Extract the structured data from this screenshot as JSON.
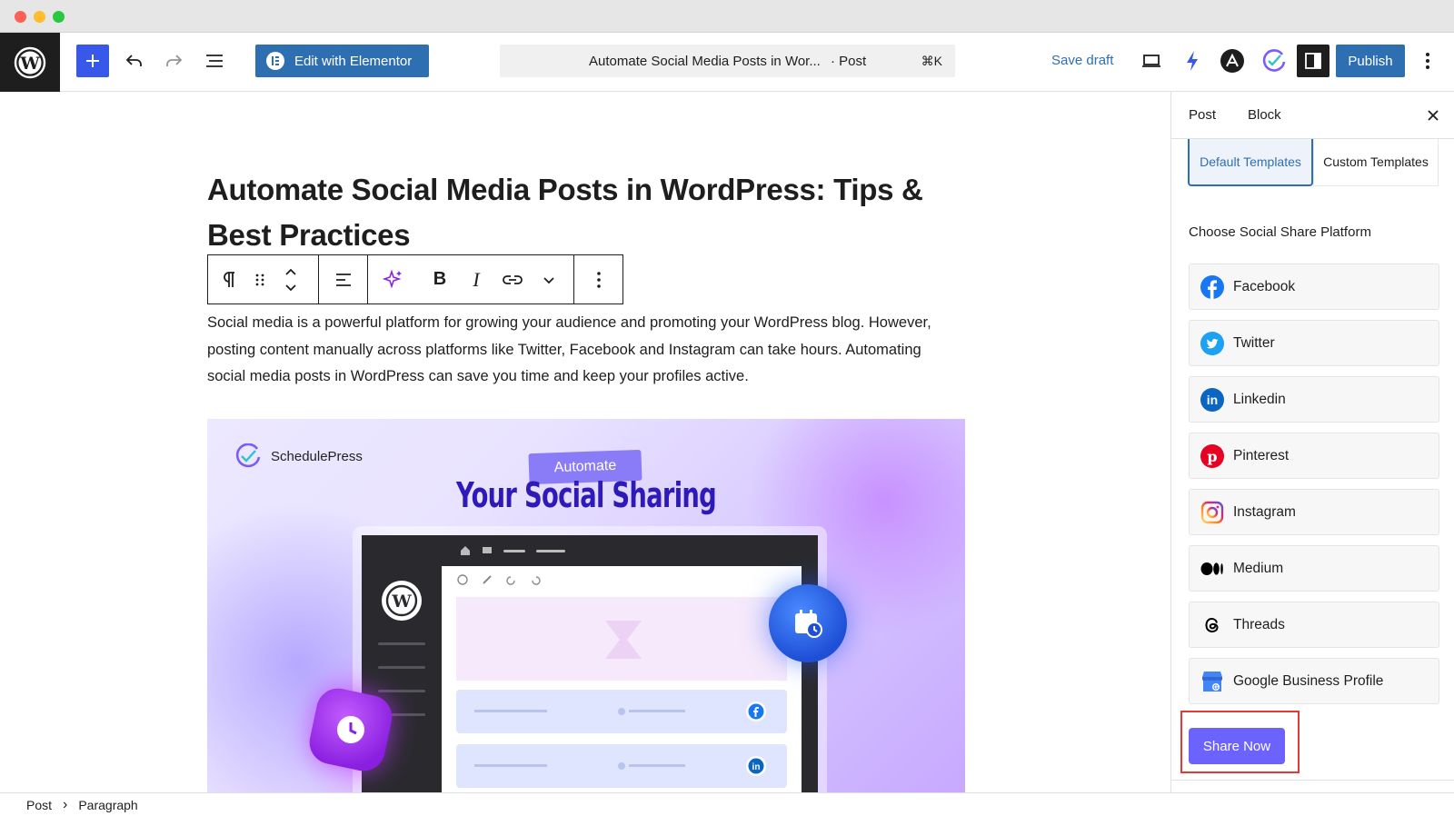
{
  "toolbar": {
    "edit_elementor_label": "Edit with Elementor",
    "command_title": "Automate Social Media Posts in Wor...",
    "command_type": "· Post",
    "command_shortcut": "⌘K",
    "save_draft_label": "Save draft",
    "publish_label": "Publish"
  },
  "editor": {
    "post_title": "Automate Social Media Posts in WordPress: Tips & Best Practices",
    "paragraph": "Social media is a powerful platform for growing your audience and promoting your WordPress blog. However, posting content manually across platforms like Twitter, Facebook and Instagram can take hours. Automating social media posts in WordPress can save you time and keep your profiles active.",
    "image": {
      "brand": "SchedulePress",
      "badge": "Automate",
      "headline": "Your Social Sharing"
    }
  },
  "sidebar": {
    "tab_post": "Post",
    "tab_block": "Block",
    "template_default": "Default Templates",
    "template_custom": "Custom Templates",
    "choose_label": "Choose Social Share Platform",
    "platforms": [
      {
        "label": "Facebook",
        "icon": "facebook-icon",
        "color": "#1877f2"
      },
      {
        "label": "Twitter",
        "icon": "twitter-icon",
        "color": "#1da1f2"
      },
      {
        "label": "Linkedin",
        "icon": "linkedin-icon",
        "color": "#0a66c2"
      },
      {
        "label": "Pinterest",
        "icon": "pinterest-icon",
        "color": "#e60023"
      },
      {
        "label": "Instagram",
        "icon": "instagram-icon",
        "color": "#e1306c"
      },
      {
        "label": "Medium",
        "icon": "medium-icon",
        "color": "#000000"
      },
      {
        "label": "Threads",
        "icon": "threads-icon",
        "color": "#000000"
      },
      {
        "label": "Google Business Profile",
        "icon": "google-business-icon",
        "color": "#4285f4"
      }
    ],
    "share_now_label": "Share Now"
  },
  "footer": {
    "crumb_post": "Post",
    "separator": "›",
    "crumb_paragraph": "Paragraph"
  },
  "colors": {
    "accent": "#2e6fb1",
    "wp_add": "#3858e9",
    "share_button": "#6c63ff",
    "highlight": "#e53935"
  }
}
